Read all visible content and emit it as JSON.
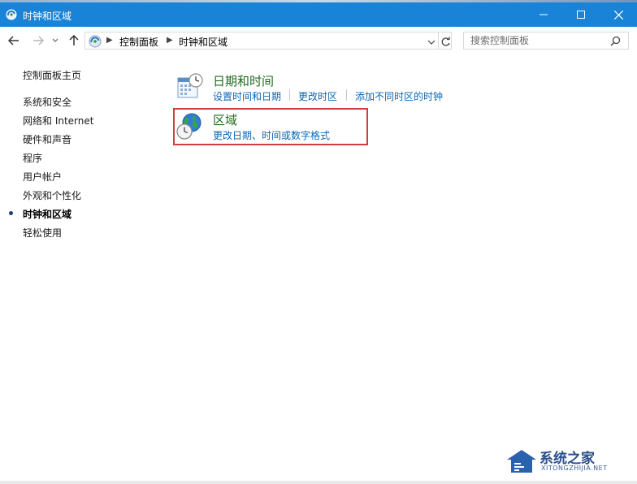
{
  "window": {
    "title": "时钟和区域"
  },
  "address": {
    "crumbs": [
      "控制面板",
      "时钟和区域"
    ]
  },
  "search": {
    "placeholder": "搜索控制面板"
  },
  "sidebar": {
    "home": "控制面板主页",
    "items": [
      {
        "label": "系统和安全"
      },
      {
        "label": "网络和 Internet"
      },
      {
        "label": "硬件和声音"
      },
      {
        "label": "程序"
      },
      {
        "label": "用户帐户"
      },
      {
        "label": "外观和个性化"
      },
      {
        "label": "时钟和区域"
      },
      {
        "label": "轻松使用"
      }
    ]
  },
  "categories": [
    {
      "title": "日期和时间",
      "links": [
        "设置时间和日期",
        "更改时区",
        "添加不同时区的时钟"
      ]
    },
    {
      "title": "区域",
      "links": [
        "更改日期、时间或数字格式"
      ]
    }
  ],
  "watermark": {
    "text": "系统之家",
    "sub": "XITONGZHIJIA.NET"
  },
  "colors": {
    "titlebar": "#1883d7",
    "link": "#0b66b3",
    "category": "#1e6b1e",
    "highlight": "#d23d3d"
  }
}
